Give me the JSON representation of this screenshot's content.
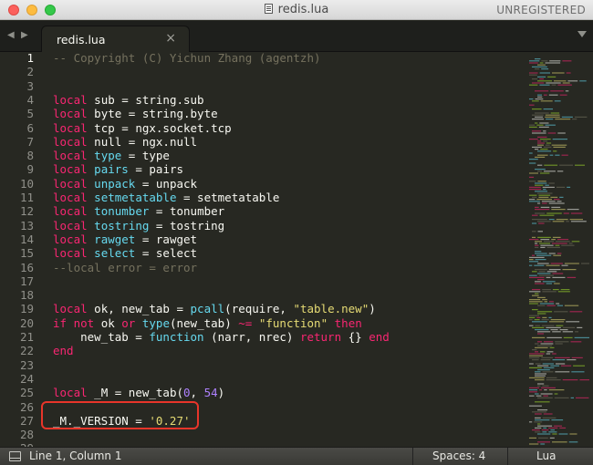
{
  "window": {
    "title": "redis.lua",
    "license_status": "UNREGISTERED"
  },
  "tabs": [
    {
      "label": "redis.lua",
      "close_glyph": "×",
      "active": true
    }
  ],
  "editor": {
    "active_line": 1,
    "highlighted_line": 27,
    "lines": [
      {
        "n": "1",
        "tokens": [
          {
            "t": "-- Copyright (C) Yichun Zhang (agentzh)",
            "c": "cm"
          }
        ]
      },
      {
        "n": "2",
        "tokens": []
      },
      {
        "n": "3",
        "tokens": []
      },
      {
        "n": "4",
        "tokens": [
          {
            "t": "local",
            "c": "kw"
          },
          {
            "t": " sub = string.sub",
            "c": ""
          }
        ]
      },
      {
        "n": "5",
        "tokens": [
          {
            "t": "local",
            "c": "kw"
          },
          {
            "t": " byte = string.byte",
            "c": ""
          }
        ]
      },
      {
        "n": "6",
        "tokens": [
          {
            "t": "local",
            "c": "kw"
          },
          {
            "t": " tcp = ngx.socket.tcp",
            "c": ""
          }
        ]
      },
      {
        "n": "7",
        "tokens": [
          {
            "t": "local",
            "c": "kw"
          },
          {
            "t": " null = ngx.null",
            "c": ""
          }
        ]
      },
      {
        "n": "8",
        "tokens": [
          {
            "t": "local",
            "c": "kw"
          },
          {
            "t": " ",
            "c": ""
          },
          {
            "t": "type",
            "c": "sb"
          },
          {
            "t": " = type",
            "c": ""
          }
        ]
      },
      {
        "n": "9",
        "tokens": [
          {
            "t": "local",
            "c": "kw"
          },
          {
            "t": " ",
            "c": ""
          },
          {
            "t": "pairs",
            "c": "sb"
          },
          {
            "t": " = pairs",
            "c": ""
          }
        ]
      },
      {
        "n": "10",
        "tokens": [
          {
            "t": "local",
            "c": "kw"
          },
          {
            "t": " ",
            "c": ""
          },
          {
            "t": "unpack",
            "c": "sb"
          },
          {
            "t": " = unpack",
            "c": ""
          }
        ]
      },
      {
        "n": "11",
        "tokens": [
          {
            "t": "local",
            "c": "kw"
          },
          {
            "t": " ",
            "c": ""
          },
          {
            "t": "setmetatable",
            "c": "sb"
          },
          {
            "t": " = setmetatable",
            "c": ""
          }
        ]
      },
      {
        "n": "12",
        "tokens": [
          {
            "t": "local",
            "c": "kw"
          },
          {
            "t": " ",
            "c": ""
          },
          {
            "t": "tonumber",
            "c": "sb"
          },
          {
            "t": " = tonumber",
            "c": ""
          }
        ]
      },
      {
        "n": "13",
        "tokens": [
          {
            "t": "local",
            "c": "kw"
          },
          {
            "t": " ",
            "c": ""
          },
          {
            "t": "tostring",
            "c": "sb"
          },
          {
            "t": " = tostring",
            "c": ""
          }
        ]
      },
      {
        "n": "14",
        "tokens": [
          {
            "t": "local",
            "c": "kw"
          },
          {
            "t": " ",
            "c": ""
          },
          {
            "t": "rawget",
            "c": "sb"
          },
          {
            "t": " = rawget",
            "c": ""
          }
        ]
      },
      {
        "n": "15",
        "tokens": [
          {
            "t": "local",
            "c": "kw"
          },
          {
            "t": " ",
            "c": ""
          },
          {
            "t": "select",
            "c": "sb"
          },
          {
            "t": " = select",
            "c": ""
          }
        ]
      },
      {
        "n": "16",
        "tokens": [
          {
            "t": "--local error = error",
            "c": "cm"
          }
        ]
      },
      {
        "n": "17",
        "tokens": []
      },
      {
        "n": "18",
        "tokens": []
      },
      {
        "n": "19",
        "tokens": [
          {
            "t": "local",
            "c": "kw"
          },
          {
            "t": " ok, new_tab = ",
            "c": ""
          },
          {
            "t": "pcall",
            "c": "sb"
          },
          {
            "t": "(require, ",
            "c": ""
          },
          {
            "t": "\"table.new\"",
            "c": "st"
          },
          {
            "t": ")",
            "c": ""
          }
        ]
      },
      {
        "n": "20",
        "tokens": [
          {
            "t": "if",
            "c": "kw"
          },
          {
            "t": " ",
            "c": ""
          },
          {
            "t": "not",
            "c": "kw"
          },
          {
            "t": " ok ",
            "c": ""
          },
          {
            "t": "or",
            "c": "kw"
          },
          {
            "t": " ",
            "c": ""
          },
          {
            "t": "type",
            "c": "sb"
          },
          {
            "t": "(new_tab) ",
            "c": ""
          },
          {
            "t": "~=",
            "c": "kw"
          },
          {
            "t": " ",
            "c": ""
          },
          {
            "t": "\"function\"",
            "c": "st"
          },
          {
            "t": " ",
            "c": ""
          },
          {
            "t": "then",
            "c": "kw"
          }
        ]
      },
      {
        "n": "21",
        "tokens": [
          {
            "t": "    new_tab = ",
            "c": ""
          },
          {
            "t": "function",
            "c": "sb"
          },
          {
            "t": " (narr, nrec) ",
            "c": ""
          },
          {
            "t": "return",
            "c": "kw"
          },
          {
            "t": " {} ",
            "c": ""
          },
          {
            "t": "end",
            "c": "kw"
          }
        ]
      },
      {
        "n": "22",
        "tokens": [
          {
            "t": "end",
            "c": "kw"
          }
        ]
      },
      {
        "n": "23",
        "tokens": []
      },
      {
        "n": "24",
        "tokens": []
      },
      {
        "n": "25",
        "tokens": [
          {
            "t": "local",
            "c": "kw"
          },
          {
            "t": " _M = new_tab(",
            "c": ""
          },
          {
            "t": "0",
            "c": "nm"
          },
          {
            "t": ", ",
            "c": ""
          },
          {
            "t": "54",
            "c": "nm"
          },
          {
            "t": ")",
            "c": ""
          }
        ]
      },
      {
        "n": "26",
        "tokens": []
      },
      {
        "n": "27",
        "tokens": [
          {
            "t": "_M._VERSION = ",
            "c": ""
          },
          {
            "t": "'0.27'",
            "c": "st"
          }
        ]
      },
      {
        "n": "28",
        "tokens": []
      },
      {
        "n": "29",
        "tokens": []
      }
    ]
  },
  "statusbar": {
    "position": "Line 1, Column 1",
    "indentation": "Spaces: 4",
    "syntax": "Lua"
  },
  "colors": {
    "background": "#272822",
    "keyword": "#f92672",
    "builtin": "#66d9ef",
    "string": "#e6db74",
    "number": "#ae81ff",
    "comment": "#75715e",
    "highlight_border": "#e8352a"
  },
  "icons": {
    "title_icon": "document-icon",
    "nav_back": "triangle-left-icon",
    "nav_forward": "triangle-right-icon",
    "tab_menu": "triangle-down-icon",
    "status_panel": "panel-toggle-icon"
  }
}
